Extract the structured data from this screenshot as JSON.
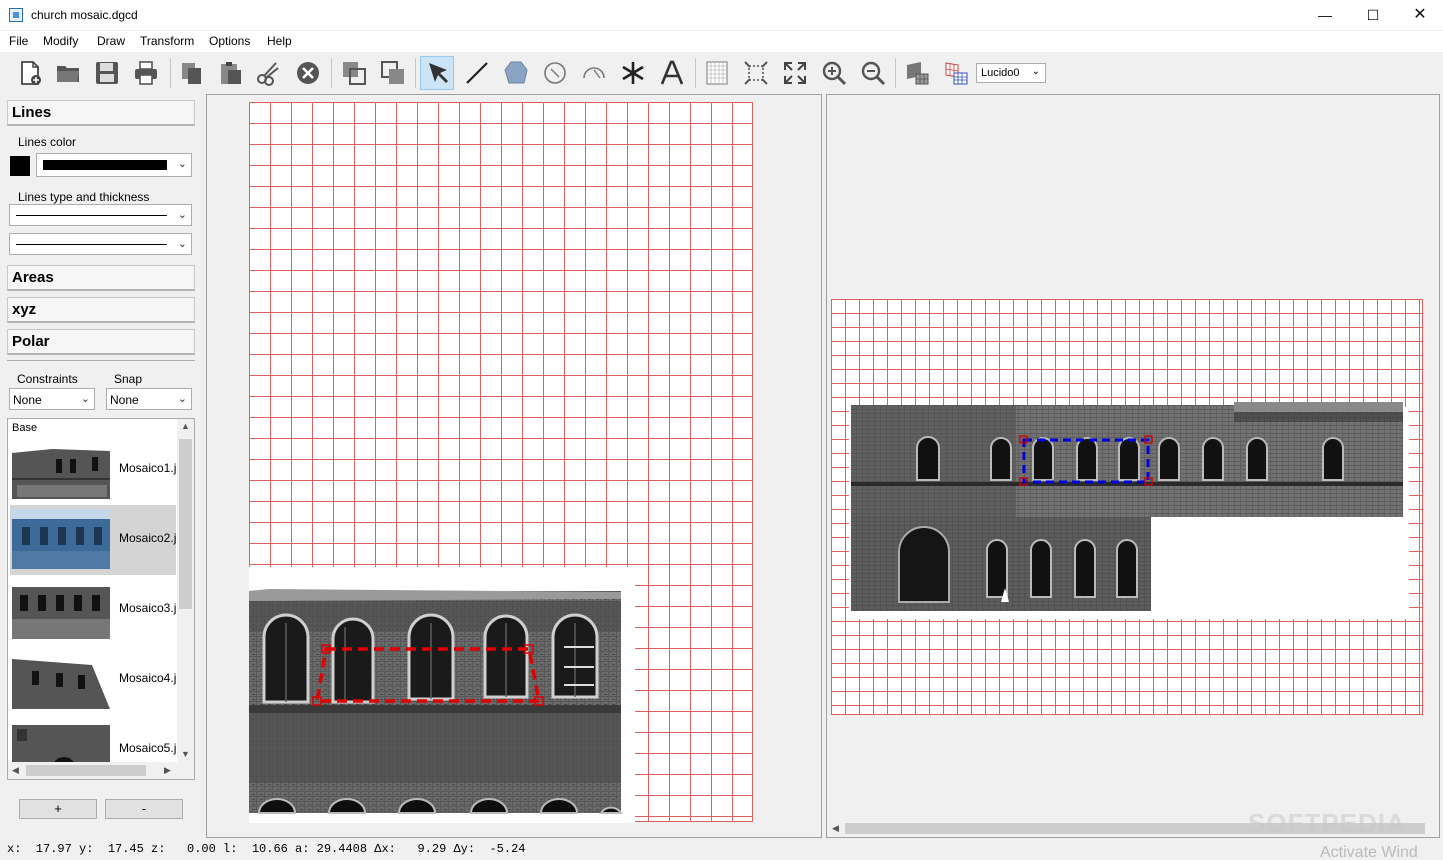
{
  "window": {
    "title": "church mosaic.dgcd",
    "minimize": "—",
    "maximize": "☐",
    "close": "✕"
  },
  "menu": [
    "File",
    "Modify",
    "Draw",
    "Transform",
    "Options",
    "Help"
  ],
  "toolbar": {
    "icons": [
      "new-file-icon",
      "open-folder-icon",
      "save-icon",
      "print-icon",
      "copy-icon",
      "paste-icon",
      "cut-icon",
      "delete-icon",
      "bring-front-icon",
      "send-back-icon",
      "select-arrow-icon",
      "line-tool-icon",
      "polygon-tool-icon",
      "circle-tool-icon",
      "arc-tool-icon",
      "point-tool-icon",
      "text-tool-icon",
      "grid-icon",
      "zoom-selection-icon",
      "zoom-extents-icon",
      "zoom-in-icon",
      "zoom-out-icon",
      "rectify-image-icon",
      "mosaic-grid-icon"
    ],
    "active_tool": "select-arrow-icon",
    "layer_select": "Lucido0"
  },
  "left_panel": {
    "lines_title": "Lines",
    "lines_color_label": "Lines color",
    "lines_color_value": "#000000",
    "lines_type_label": "Lines type and thickness",
    "areas_title": "Areas",
    "xyz_title": "xyz",
    "polar_title": "Polar",
    "constraints_label": "Constraints",
    "constraints_value": "None",
    "snap_label": "Snap",
    "snap_value": "None",
    "list_header": "Base",
    "images": [
      {
        "label": "Mosaico1.j",
        "selected": false
      },
      {
        "label": "Mosaico2.j",
        "selected": true
      },
      {
        "label": "Mosaico3.j",
        "selected": false
      },
      {
        "label": "Mosaico4.j",
        "selected": false
      },
      {
        "label": "Mosaico5.j",
        "selected": false
      }
    ],
    "add_button": "+",
    "remove_button": "-"
  },
  "status": {
    "text": "x:  17.97 y:  17.45 z:   0.00 l:  10.66 a: 29.4408 Δx:   9.29 Δy:  -5.24"
  },
  "overlay": {
    "watermark": "SOFTPEDIA",
    "activate_text": "Activate Wind"
  },
  "colors": {
    "grid": "#e06060",
    "selection_left": "#e00000",
    "selection_right": "#0000dd",
    "active_tool_bg": "#cce4f7"
  }
}
